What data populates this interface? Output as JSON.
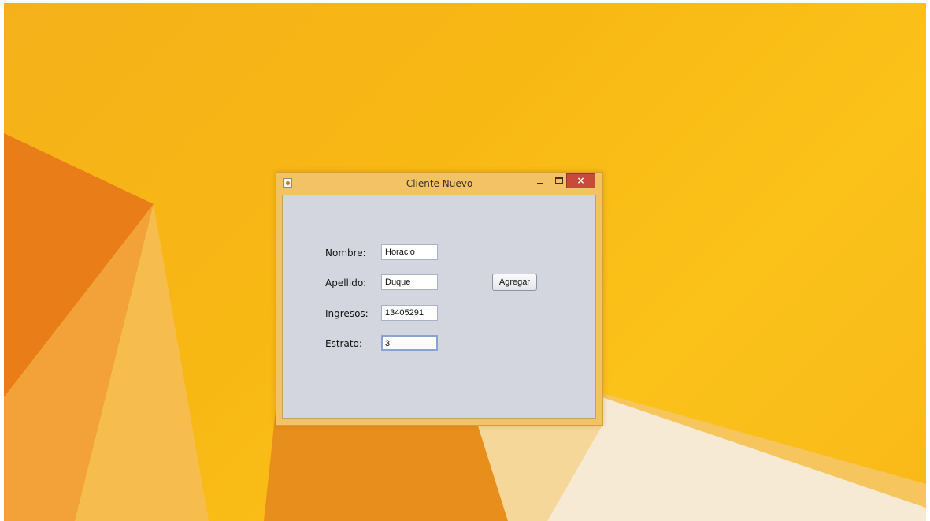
{
  "window": {
    "title": "Cliente Nuevo",
    "close_glyph": "×"
  },
  "form": {
    "nombre_label": "Nombre:",
    "nombre_value": "Horacio",
    "apellido_label": "Apellido:",
    "apellido_value": "Duque",
    "ingresos_label": "Ingresos:",
    "ingresos_value": "13405291",
    "estrato_label": "Estrato:",
    "estrato_value": "3",
    "add_button_label": "Agregar"
  },
  "icons": {
    "app": "java-cup-icon",
    "minimize": "minimize-icon",
    "maximize": "maximize-icon",
    "close": "close-icon"
  },
  "colors": {
    "desktop": "#f8b814",
    "title_bar": "#f2c265",
    "client_area": "#d3d6de",
    "close_button": "#c84a3a"
  }
}
